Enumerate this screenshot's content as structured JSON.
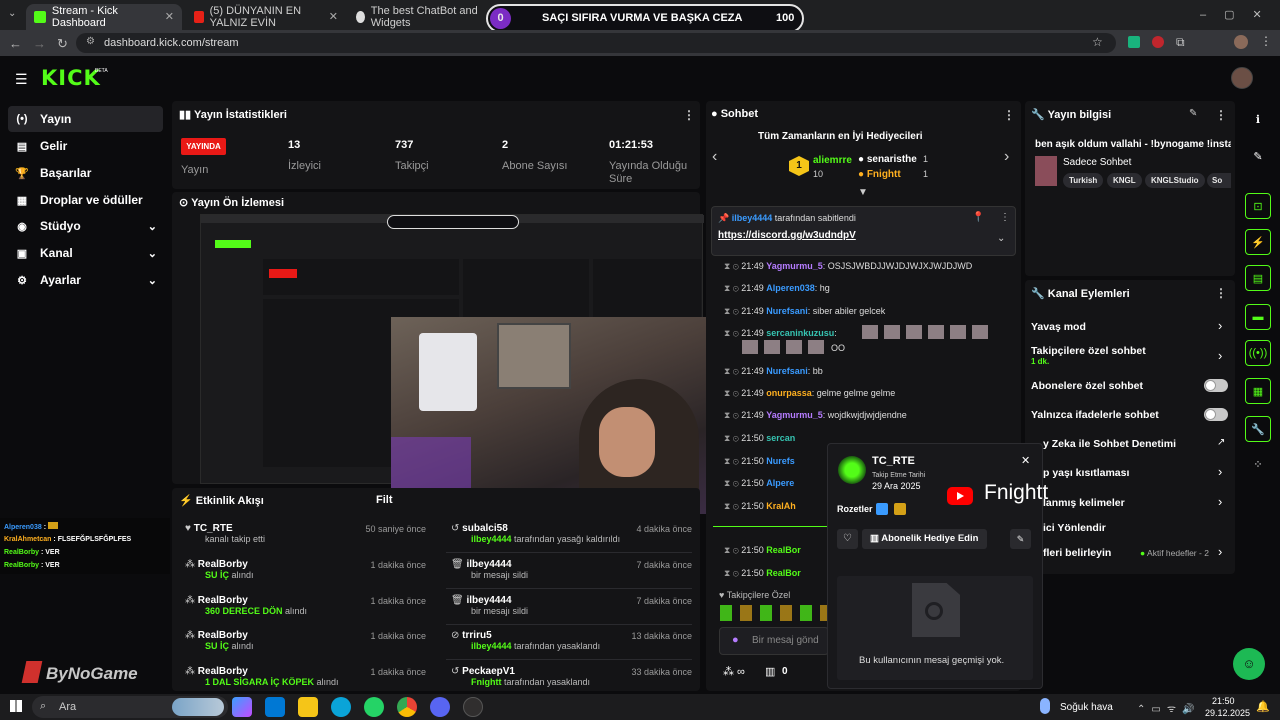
{
  "browser": {
    "tabs": [
      "Stream - Kick Dashboard",
      "(5) DÜNYANIN EN YALNIZ EVİN",
      "The best ChatBot and Widgets"
    ],
    "url": "dashboard.kick.com/stream"
  },
  "goal": {
    "left": "0",
    "title": "SAÇI SIFIRA VURMA VE BAŞKA CEZA",
    "right": "100"
  },
  "brand": {
    "logo": "KICK",
    "beta": "BETA"
  },
  "sidebar": {
    "items": [
      {
        "label": "Yayın"
      },
      {
        "label": "Gelir"
      },
      {
        "label": "Başarılar"
      },
      {
        "label": "Droplar ve ödüller"
      },
      {
        "label": "Stüdyo"
      },
      {
        "label": "Kanal"
      },
      {
        "label": "Ayarlar"
      }
    ]
  },
  "stats": {
    "title": "Yayın İstatistikleri",
    "live_badge": "YAYINDA",
    "live_label": "Yayın",
    "items": [
      {
        "value": "13",
        "label": "İzleyici"
      },
      {
        "value": "737",
        "label": "Takipçi"
      },
      {
        "value": "2",
        "label": "Abone Sayısı"
      },
      {
        "value": "01:21:53",
        "label": "Yayında Olduğu Süre"
      }
    ]
  },
  "preview": {
    "title": "Yayın Ön İzlemesi"
  },
  "chat": {
    "title": "Sohbet",
    "gifters_title": "Tüm Zamanların en İyi Hediyecileri",
    "gifters": [
      {
        "rank": "1",
        "name": "aliemrre",
        "count": "10"
      },
      {
        "name": "senaristhe",
        "count": "1"
      },
      {
        "name": "Fnightt",
        "count": "1"
      }
    ],
    "pinned_by": "ilbey4444",
    "pinned_suffix": "tarafından sabitlendi",
    "pinned_link": "https://discord.gg/w3udndpV",
    "messages": [
      {
        "time": "21:49",
        "user": "Yagmurmu_5",
        "text": ": OSJSJWBDJJWJDJWJXJWJDJWD",
        "color": "#b57cff"
      },
      {
        "time": "21:49",
        "user": "Alperen038",
        "text": ": hg",
        "color": "#3a9bff"
      },
      {
        "time": "21:49",
        "user": "Nurefsani",
        "text": ": siber abiler gelcek",
        "color": "#3a9bff"
      },
      {
        "time": "21:49",
        "user": "sercaninkuzusu",
        "text": ":",
        "color": "#36c3b1"
      },
      {
        "time": "",
        "user": "",
        "text": "OO",
        "color": "#fff"
      },
      {
        "time": "21:49",
        "user": "Nurefsani",
        "text": ": bb",
        "color": "#3a9bff"
      },
      {
        "time": "21:49",
        "user": "onurpassa",
        "text": ": gelme gelme gelme",
        "color": "#ffb020"
      },
      {
        "time": "21:49",
        "user": "Yagmurmu_5",
        "text": ": wojdkwjdjwjdjendne",
        "color": "#b57cff"
      },
      {
        "time": "21:50",
        "user": "sercan",
        "text": "",
        "color": "#36c3b1"
      },
      {
        "time": "21:50",
        "user": "Nurefs",
        "text": "",
        "color": "#3a9bff"
      },
      {
        "time": "21:50",
        "user": "Alpere",
        "text": "",
        "color": "#3a9bff"
      },
      {
        "time": "21:50",
        "user": "KralAh",
        "text": "",
        "color": "#ffb020"
      },
      {
        "time": "21:50",
        "user": "RealBor",
        "text": "",
        "color": "#53fc18"
      },
      {
        "time": "21:50",
        "user": "RealBor",
        "text": "",
        "color": "#53fc18"
      }
    ],
    "followers_only": "Takipçilere Özel",
    "input_placeholder": "Bir mesaj gönd",
    "bottom_count": "0"
  },
  "stream_info": {
    "title": "Yayın bilgisi",
    "stream_title": "ben aşık oldum vallahi - !bynogame !insta",
    "category": "Sadece Sohbet",
    "tags": [
      "Turkish",
      "KNGL",
      "KNGLStudio",
      "So"
    ]
  },
  "channel_actions": {
    "title": "Kanal Eylemleri",
    "items": [
      {
        "label": "Yavaş mod"
      },
      {
        "label": "Takipçilere özel sohbet",
        "sub": "1 dk."
      },
      {
        "label": "Abonelere özel sohbet"
      },
      {
        "label": "Yalnızca ifadelerle sohbet"
      },
      {
        "label": "y Zeka ile Sohbet Denetimi"
      },
      {
        "label": "p yaşı kısıtlaması"
      },
      {
        "label": "lanmış kelimeler"
      },
      {
        "label": "ici Yönlendir"
      },
      {
        "label": "fleri belirleyin",
        "extra": "Aktif hedefler - 2"
      }
    ]
  },
  "events": {
    "title": "Etkinlik Akışı",
    "filter": "Filt",
    "left": [
      {
        "name": "TC_RTE",
        "sub": "kanalı takip etti",
        "hl": "",
        "time": "50 saniye önce"
      },
      {
        "name": "RealBorby",
        "hl": "SU İÇ",
        "sub": " alındı",
        "time": "1 dakika önce"
      },
      {
        "name": "RealBorby",
        "hl": "360 DERECE DÖN",
        "sub": " alındı",
        "time": "1 dakika önce"
      },
      {
        "name": "RealBorby",
        "hl": "SU İÇ",
        "sub": " alındı",
        "time": "1 dakika önce"
      },
      {
        "name": "RealBorby",
        "hl": "1 DAL SİGARA İÇ KÖPEK",
        "sub": " alındı",
        "time": "1 dakika önce"
      }
    ],
    "right": [
      {
        "name": "subalci58",
        "hl": "ilbey4444",
        "sub": " tarafından yasağı kaldırıldı",
        "time": "4 dakika önce"
      },
      {
        "name": "ilbey4444",
        "hl": "",
        "sub": "bir mesajı sildi",
        "time": "7 dakika önce"
      },
      {
        "name": "ilbey4444",
        "hl": "",
        "sub": "bir mesajı sildi",
        "time": "7 dakika önce"
      },
      {
        "name": "trriru5",
        "hl": "ilbey4444",
        "sub": " tarafından yasaklandı",
        "time": "13 dakika önce"
      },
      {
        "name": "PeckaepV1",
        "hl": "Fnightt",
        "sub": " tarafından yasaklandı",
        "time": "33 dakika önce"
      }
    ]
  },
  "overlay_chat": [
    {
      "user": "Alperen038",
      "text": " :",
      "color": "#3a9bff"
    },
    {
      "user": "KralAhmetcan",
      "text": " : FLSEFĞPLSFĞPLFES",
      "color": "#ffb020"
    },
    {
      "user": "RealBorby",
      "text": " : VER",
      "color": "#53fc18"
    },
    {
      "user": "RealBorby",
      "text": " : VER",
      "color": "#53fc18"
    }
  ],
  "user_card": {
    "name": "TC_RTE",
    "follow_label": "Takip Etme Tarihi",
    "follow_date": "29 Ara 2025",
    "badges_label": "Rozetler",
    "gift_button": "Abonelik Hediye Edin",
    "no_history": "Bu kullanıcının mesaj geçmişi yok."
  },
  "youtube": {
    "name": "Fnightt"
  },
  "watermark": "ByNoGame",
  "taskbar": {
    "search": "Ara",
    "weather": "Soğuk hava",
    "time": "21:50",
    "date": "29.12.2025"
  },
  "colors": {
    "accent": "#53fc18",
    "live": "#e91916",
    "bg": "#0b0b0d",
    "panel": "#141416"
  }
}
